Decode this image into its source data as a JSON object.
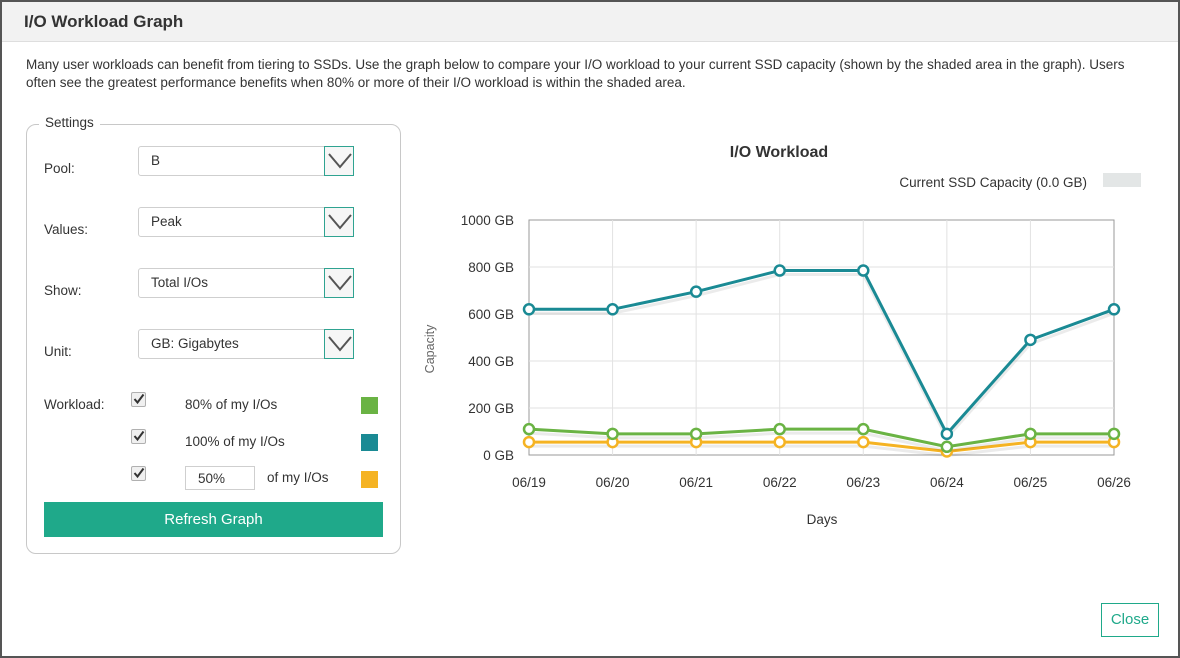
{
  "dialog": {
    "title": "I/O Workload Graph",
    "description": "Many user workloads can benefit from tiering to SSDs. Use the graph below to compare your I/O workload to your current SSD capacity (shown by the shaded area in the graph). Users often see the greatest performance benefits when 80% or more of their I/O workload is within the shaded area.",
    "close_label": "Close"
  },
  "settings": {
    "legend": "Settings",
    "pool": {
      "label": "Pool:",
      "value": "B"
    },
    "values": {
      "label": "Values:",
      "value": "Peak"
    },
    "show": {
      "label": "Show:",
      "value": "Total I/Os"
    },
    "unit": {
      "label": "Unit:",
      "value": "GB: Gigabytes"
    },
    "workload": {
      "label": "Workload:",
      "items": [
        {
          "label": "80% of my I/Os",
          "checked": true,
          "color": "#6ab344"
        },
        {
          "label": "100% of my I/Os",
          "checked": true,
          "color": "#1a8a94"
        },
        {
          "label": "of my I/Os",
          "value": "50%",
          "checked": true,
          "color": "#f5b323"
        }
      ]
    },
    "refresh_label": "Refresh Graph"
  },
  "chart_data": {
    "type": "line",
    "title": "I/O Workload",
    "xlabel": "Days",
    "ylabel": "Capacity",
    "categories": [
      "06/19",
      "06/20",
      "06/21",
      "06/22",
      "06/23",
      "06/24",
      "06/25",
      "06/26"
    ],
    "yticks": [
      "0 GB",
      "200 GB",
      "400 GB",
      "600 GB",
      "800 GB",
      "1000 GB"
    ],
    "ylim": [
      0,
      1000
    ],
    "grid": true,
    "legend": {
      "label": "Current SSD Capacity (0.0 GB)",
      "color": "#e3e6e6",
      "placement": "top-right"
    },
    "series": [
      {
        "name": "100% of my I/Os",
        "color": "#1a8a94",
        "values": [
          620,
          620,
          695,
          785,
          785,
          90,
          490,
          620
        ]
      },
      {
        "name": "80% of my I/Os",
        "color": "#6ab344",
        "values": [
          110,
          90,
          90,
          110,
          110,
          35,
          90,
          90
        ]
      },
      {
        "name": "50% of my I/Os",
        "color": "#f5b323",
        "values": [
          55,
          55,
          55,
          55,
          55,
          15,
          55,
          55
        ]
      }
    ]
  }
}
